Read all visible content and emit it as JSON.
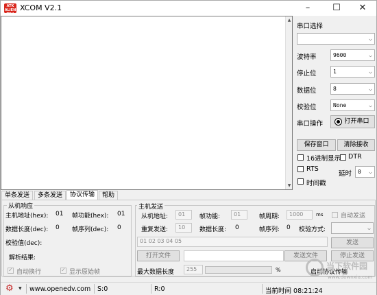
{
  "window": {
    "logo_text": "ATK ALIEN TEK",
    "title": "XCOM V2.1",
    "minimize": "–",
    "maximize": "☐",
    "close": "✕"
  },
  "serial": {
    "port_select_label": "串口选择",
    "port_value": "",
    "baud_label": "波特率",
    "baud_value": "9600",
    "stopbit_label": "停止位",
    "stopbit_value": "1",
    "databit_label": "数据位",
    "databit_value": "8",
    "parity_label": "校验位",
    "parity_value": "None",
    "op_label": "串口操作",
    "open_button": "打开串口",
    "save_window_button": "保存窗口",
    "clear_recv_button": "清除接收",
    "hex_display_label": "16进制显示",
    "dtr_label": "DTR",
    "rts_label": "RTS",
    "delay_label": "延时",
    "delay_value": "0",
    "timestamp_label": "时间戳"
  },
  "tabs": [
    "单条发送",
    "多条发送",
    "协议传输",
    "帮助"
  ],
  "slave": {
    "title": "从机响应",
    "addr_label": "主机地址(hex):",
    "addr_value": "01",
    "func_label": "帧功能(hex):",
    "func_value": "01",
    "len_label": "数据长度(dec):",
    "len_value": "0",
    "seq_label": "帧序列(dec):",
    "seq_value": "0",
    "check_label": "校验值(dec):",
    "parse_label": "解析结果:",
    "auto_wrap_label": "自动换行",
    "raw_frame_label": "显示原始帧"
  },
  "master": {
    "title": "主机发送",
    "addr_label": "从机地址:",
    "addr_value": "01",
    "func_label": "帧功能:",
    "func_value": "01",
    "period_label": "帧周期:",
    "period_value": "1000",
    "period_unit": "ms",
    "auto_send_label": "自动发送",
    "repeat_label": "重复发送:",
    "repeat_value": "10",
    "len_label": "数据长度:",
    "len_value": "0",
    "seq_label": "帧序列:",
    "seq_value": "0",
    "checkmode_label": "校验方式:",
    "checkmode_value": "",
    "data_value": "01 02 03 04 05",
    "send_button": "发送",
    "open_file_button": "打开文件",
    "send_file_button": "发送文件",
    "stop_send_button": "停止发送",
    "max_len_label": "最大数据长度",
    "max_len_value": "255",
    "progress_unit": "%",
    "start_protocol_label": "启动协议传输"
  },
  "statusbar": {
    "url": "www.openedv.com",
    "s_count": "S:0",
    "r_count": "R:0",
    "time": "当前时间 08:21:24"
  },
  "watermark": {
    "text": "当下软件园",
    "url": "www.downxia.com"
  },
  "icons": {
    "settings": "gear-icon",
    "dropdown": "chevron-down-icon"
  }
}
